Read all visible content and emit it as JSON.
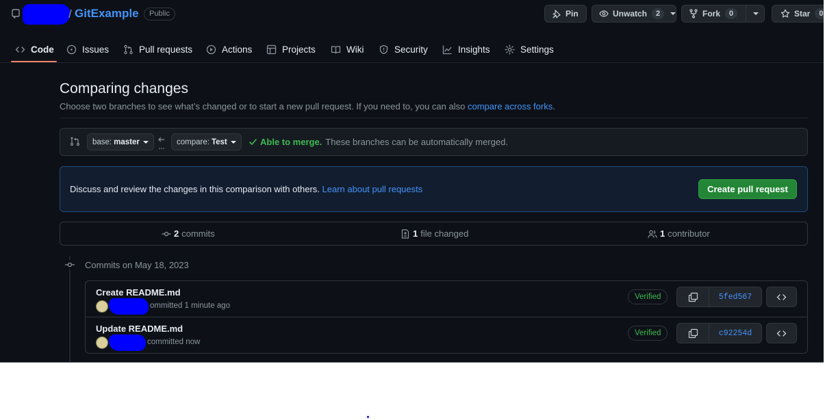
{
  "repo": {
    "slash": "/",
    "name": "GitExample",
    "visibility": "Public"
  },
  "header_actions": {
    "pin": "Pin",
    "unwatch": "Unwatch",
    "watch_count": "2",
    "fork": "Fork",
    "fork_count": "0",
    "star": "Star",
    "star_count": "0"
  },
  "nav": {
    "tabs": [
      {
        "label": "Code",
        "icon": "code-icon",
        "active": true
      },
      {
        "label": "Issues",
        "icon": "issue-icon"
      },
      {
        "label": "Pull requests",
        "icon": "pull-request-icon"
      },
      {
        "label": "Actions",
        "icon": "play-icon"
      },
      {
        "label": "Projects",
        "icon": "table-icon"
      },
      {
        "label": "Wiki",
        "icon": "book-icon"
      },
      {
        "label": "Security",
        "icon": "shield-icon"
      },
      {
        "label": "Insights",
        "icon": "graph-icon"
      },
      {
        "label": "Settings",
        "icon": "gear-icon"
      }
    ]
  },
  "compare": {
    "title": "Comparing changes",
    "subtitle": "Choose two branches to see what’s changed or to start a new pull request. If you need to, you can also ",
    "subtitle_link": "compare across forks",
    "subtitle_end": ".",
    "base_label": "base:",
    "base_value": "master",
    "compare_label": "compare:",
    "compare_value": "Test",
    "merge_status": "Able to merge.",
    "merge_note": "These branches can be automatically merged."
  },
  "discuss": {
    "text": "Discuss and review the changes in this comparison with others.",
    "link": "Learn about pull requests",
    "button": "Create pull request"
  },
  "stats": {
    "commits_count": "2",
    "commits_label": "commits",
    "files_count": "1",
    "files_label": "file changed",
    "contributors_count": "1",
    "contributors_label": "contributor"
  },
  "commits": {
    "date_heading": "Commits on May 18, 2023",
    "items": [
      {
        "title": "Create README.md",
        "meta": "ommitted 1 minute ago",
        "badge": "Verified",
        "sha": "5fed567"
      },
      {
        "title": "Update README.md",
        "meta": "committed now",
        "badge": "Verified",
        "sha": "c92254d"
      }
    ]
  },
  "colors": {
    "background": "#0d1117",
    "link": "#4493f8",
    "success": "#3fb950",
    "primary_button": "#238636",
    "redaction": "#0000ff"
  }
}
